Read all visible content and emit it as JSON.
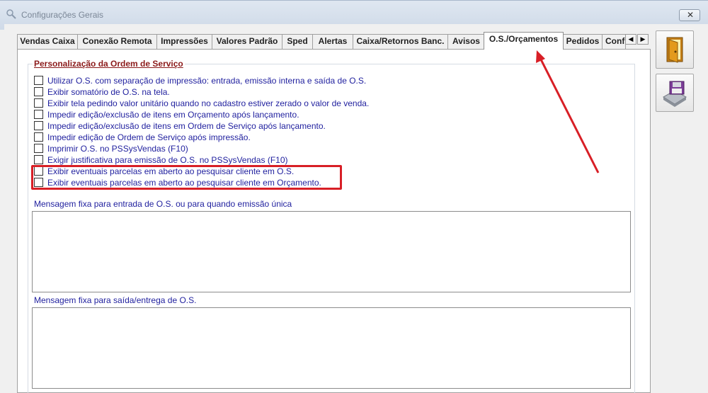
{
  "window": {
    "title": "Configurações Gerais",
    "close_label": "✕"
  },
  "tabs": [
    {
      "label": "Vendas Caixa"
    },
    {
      "label": "Conexão Remota"
    },
    {
      "label": "Impressões"
    },
    {
      "label": "Valores Padrão"
    },
    {
      "label": "Sped"
    },
    {
      "label": "Alertas"
    },
    {
      "label": "Caixa/Retornos Banc."
    },
    {
      "label": "Avisos"
    },
    {
      "label": "O.S./Orçamentos",
      "active": true
    },
    {
      "label": "Pedidos"
    },
    {
      "label": "Conf"
    }
  ],
  "tab_scroll": {
    "left": "◀",
    "right": "▶"
  },
  "group": {
    "title": "Personalização da Ordem de Serviço"
  },
  "options": [
    {
      "label": "Utilizar O.S. com separação de impressão: entrada, emissão interna e saída de O.S.",
      "checked": false
    },
    {
      "label": "Exibir somatório de O.S. na tela.",
      "checked": false
    },
    {
      "label": "Exibir tela pedindo valor unitário quando no cadastro estiver zerado o valor de venda.",
      "checked": false
    },
    {
      "label": "Impedir edição/exclusão de itens em Orçamento após lançamento.",
      "checked": false
    },
    {
      "label": "Impedir edição/exclusão de itens em Ordem de Serviço após lançamento.",
      "checked": false
    },
    {
      "label": "Impedir edição de Ordem de Serviço após impressão.",
      "checked": false
    },
    {
      "label": "Imprimir O.S. no PSSysVendas (F10)",
      "checked": false
    },
    {
      "label": "Exigir justificativa para emissão de O.S. no PSSysVendas (F10)",
      "checked": false
    },
    {
      "label": "Exibir eventuais parcelas em aberto ao pesquisar cliente em O.S.",
      "checked": false
    },
    {
      "label": "Exibir eventuais parcelas em aberto ao pesquisar cliente em Orçamento.",
      "checked": false
    }
  ],
  "messages": {
    "entry_label": "Mensagem fixa para entrada de O.S. ou para quando emissão única",
    "entry_value": "",
    "exit_label": "Mensagem fixa para saída/entrega de O.S.",
    "exit_value": ""
  },
  "side_buttons": {
    "exit_icon": "door-exit-icon",
    "save_icon": "floppy-disk-icon"
  },
  "colors": {
    "label_blue": "#1f1f9e",
    "group_title": "#8b1a1a",
    "annotation_red": "#d81f26"
  }
}
